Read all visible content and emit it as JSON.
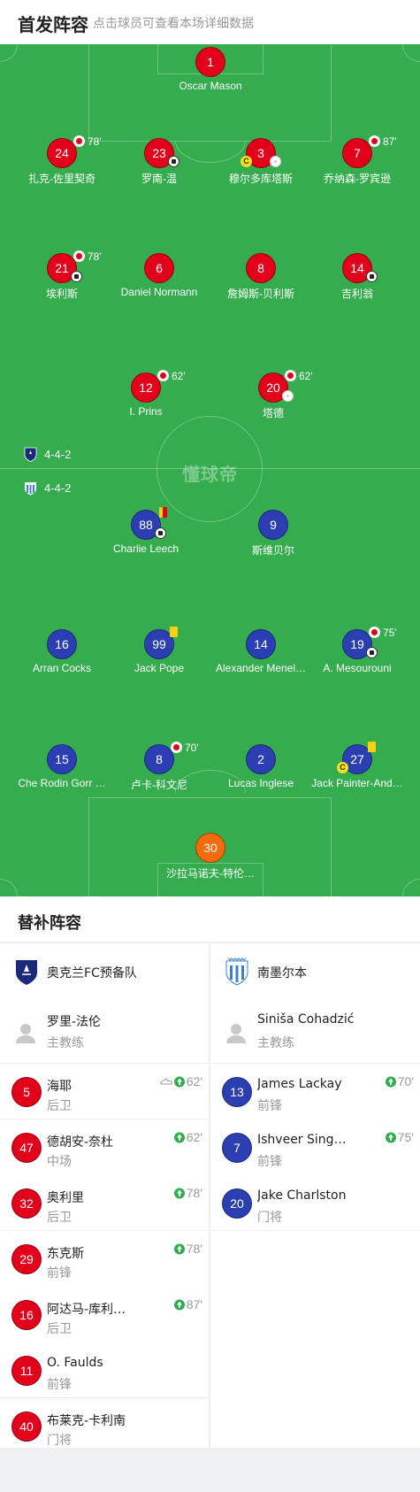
{
  "header": {
    "title": "首发阵容",
    "subtitle": "点击球员可查看本场详细数据"
  },
  "pitch": {
    "watermark": "懂球帝"
  },
  "formations": {
    "home": "4-4-2",
    "away": "4-4-2"
  },
  "home_players": [
    {
      "num": "1",
      "name": "Oscar Mason"
    },
    {
      "num": "24",
      "name": "扎克-佐里契奇",
      "sub": "78'"
    },
    {
      "num": "23",
      "name": "罗南-温"
    },
    {
      "num": "3",
      "name": "穆尔多库塔斯",
      "captain": "C"
    },
    {
      "num": "7",
      "name": "乔纳森-罗宾逊",
      "sub": "87'"
    },
    {
      "num": "21",
      "name": "埃利斯",
      "sub": "78'"
    },
    {
      "num": "6",
      "name": "Daniel Normann"
    },
    {
      "num": "8",
      "name": "詹姆斯-贝利斯"
    },
    {
      "num": "14",
      "name": "吉利翁"
    },
    {
      "num": "12",
      "name": "I. Prins",
      "sub": "62'"
    },
    {
      "num": "20",
      "name": "塔德",
      "sub": "62'"
    }
  ],
  "away_players": [
    {
      "num": "88",
      "name": "Charlie Leech"
    },
    {
      "num": "9",
      "name": "斯维贝尔"
    },
    {
      "num": "16",
      "name": "Arran Cocks"
    },
    {
      "num": "99",
      "name": "Jack Pope"
    },
    {
      "num": "14",
      "name": "Alexander Menel…"
    },
    {
      "num": "19",
      "name": "A. Mesourouni",
      "sub": "75'"
    },
    {
      "num": "15",
      "name": "Che Rodin Gorr …"
    },
    {
      "num": "8",
      "name": "卢卡-科文尼",
      "sub": "70'"
    },
    {
      "num": "2",
      "name": "Lucas Inglese"
    },
    {
      "num": "27",
      "name": "Jack Painter-And…",
      "captain": "C"
    },
    {
      "num": "30",
      "name": "沙拉马诺夫-特伦…"
    }
  ],
  "subs": {
    "title": "替补阵容",
    "home": {
      "team": "奥克兰FC预备队",
      "coach": {
        "name": "罗里-法伦",
        "role": "主教练"
      },
      "players": [
        {
          "num": "5",
          "name": "海耶",
          "pos": "后卫",
          "time": "62'"
        },
        {
          "num": "47",
          "name": "德胡安-奈杜",
          "pos": "中场",
          "time": "62'"
        },
        {
          "num": "32",
          "name": "奥利里",
          "pos": "后卫",
          "time": "78'"
        },
        {
          "num": "29",
          "name": "东克斯",
          "pos": "前锋",
          "time": "78'"
        },
        {
          "num": "16",
          "name": "阿达马-库利…",
          "pos": "后卫",
          "time": "87'"
        },
        {
          "num": "11",
          "name": "O. Faulds",
          "pos": "前锋",
          "time": ""
        },
        {
          "num": "40",
          "name": "布莱克-卡利南",
          "pos": "门将",
          "time": ""
        }
      ]
    },
    "away": {
      "team": "南墨尔本",
      "coach": {
        "name": "Siniša Cohadzić",
        "role": "主教练"
      },
      "players": [
        {
          "num": "13",
          "name": "James Lackay",
          "pos": "前锋",
          "time": "70'"
        },
        {
          "num": "7",
          "name": "Ishveer Singh…",
          "pos": "前锋",
          "time": "75'"
        },
        {
          "num": "20",
          "name": "Jake Charlston",
          "pos": "门将",
          "time": ""
        }
      ]
    }
  },
  "colors": {
    "pitch": "#35ad4e",
    "home": "#e3001b",
    "away": "#2b3fb3",
    "keeper": "#f36b0c"
  }
}
